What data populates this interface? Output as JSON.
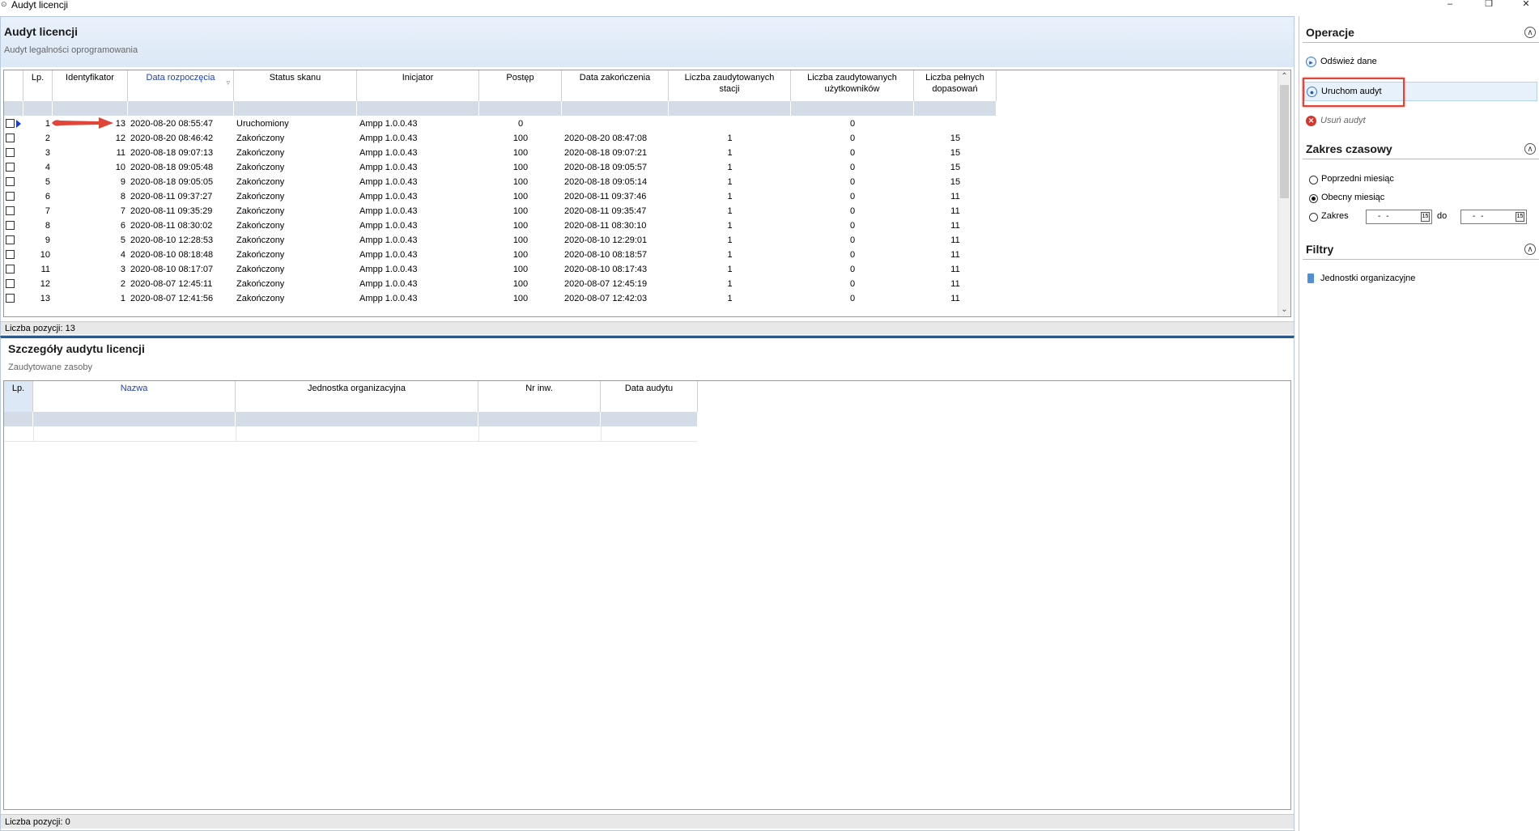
{
  "window": {
    "title": "Audyt licencji",
    "minimize": "–",
    "maximize": "❐",
    "close": "✕"
  },
  "audit_panel": {
    "title": "Audyt licencji",
    "subtitle": "Audyt legalności oprogramowania",
    "columns": [
      "Lp.",
      "Identyfikator",
      "Data rozpoczęcia",
      "Status skanu",
      "Inicjator",
      "Postęp",
      "Data zakończenia",
      "Liczba zaudytowanych stacji",
      "Liczba zaudytowanych użytkowników",
      "Liczba pełnych dopasowań"
    ],
    "rows": [
      [
        "1",
        "13",
        "2020-08-20 08:55:47",
        "Uruchomiony",
        "Ampp 1.0.0.43",
        "0",
        "",
        "",
        "0",
        ""
      ],
      [
        "2",
        "12",
        "2020-08-20 08:46:42",
        "Zakończony",
        "Ampp 1.0.0.43",
        "100",
        "2020-08-20 08:47:08",
        "1",
        "0",
        "15"
      ],
      [
        "3",
        "11",
        "2020-08-18 09:07:13",
        "Zakończony",
        "Ampp 1.0.0.43",
        "100",
        "2020-08-18 09:07:21",
        "1",
        "0",
        "15"
      ],
      [
        "4",
        "10",
        "2020-08-18 09:05:48",
        "Zakończony",
        "Ampp 1.0.0.43",
        "100",
        "2020-08-18 09:05:57",
        "1",
        "0",
        "15"
      ],
      [
        "5",
        "9",
        "2020-08-18 09:05:05",
        "Zakończony",
        "Ampp 1.0.0.43",
        "100",
        "2020-08-18 09:05:14",
        "1",
        "0",
        "15"
      ],
      [
        "6",
        "8",
        "2020-08-11 09:37:27",
        "Zakończony",
        "Ampp 1.0.0.43",
        "100",
        "2020-08-11 09:37:46",
        "1",
        "0",
        "11"
      ],
      [
        "7",
        "7",
        "2020-08-11 09:35:29",
        "Zakończony",
        "Ampp 1.0.0.43",
        "100",
        "2020-08-11 09:35:47",
        "1",
        "0",
        "11"
      ],
      [
        "8",
        "6",
        "2020-08-11 08:30:02",
        "Zakończony",
        "Ampp 1.0.0.43",
        "100",
        "2020-08-11 08:30:10",
        "1",
        "0",
        "11"
      ],
      [
        "9",
        "5",
        "2020-08-10 12:28:53",
        "Zakończony",
        "Ampp 1.0.0.43",
        "100",
        "2020-08-10 12:29:01",
        "1",
        "0",
        "11"
      ],
      [
        "10",
        "4",
        "2020-08-10 08:18:48",
        "Zakończony",
        "Ampp 1.0.0.43",
        "100",
        "2020-08-10 08:18:57",
        "1",
        "0",
        "11"
      ],
      [
        "11",
        "3",
        "2020-08-10 08:17:07",
        "Zakończony",
        "Ampp 1.0.0.43",
        "100",
        "2020-08-10 08:17:43",
        "1",
        "0",
        "11"
      ],
      [
        "12",
        "2",
        "2020-08-07 12:45:11",
        "Zakończony",
        "Ampp 1.0.0.43",
        "100",
        "2020-08-07 12:45:19",
        "1",
        "0",
        "11"
      ],
      [
        "13",
        "1",
        "2020-08-07 12:41:56",
        "Zakończony",
        "Ampp 1.0.0.43",
        "100",
        "2020-08-07 12:42:03",
        "1",
        "0",
        "11"
      ]
    ],
    "footer": "Liczba pozycji: 13"
  },
  "details_panel": {
    "title": "Szczegóły audytu licencji",
    "subtitle": "Zaudytowane zasoby",
    "columns": [
      "Lp.",
      "Nazwa",
      "Jednostka organizacyjna",
      "Nr inw.",
      "Data audytu"
    ],
    "footer": "Liczba pozycji: 0"
  },
  "sidebar": {
    "operations": {
      "title": "Operacje",
      "items": [
        "Odśwież dane",
        "Uruchom audyt",
        "Usuń audyt"
      ]
    },
    "time_range": {
      "title": "Zakres czasowy",
      "options": [
        "Poprzedni miesiąc",
        "Obecny miesiąc",
        "Zakres"
      ],
      "selected": "Obecny miesiąc",
      "date_from": "- -",
      "date_to_label": "do",
      "date_to": "- -",
      "calendar_glyph": "15"
    },
    "filters": {
      "title": "Filtry",
      "items": [
        "Jednostki organizacyjne"
      ]
    }
  },
  "colors": {
    "accent_blue": "#1a3fd0",
    "header_gradient": "#dce8f6",
    "highlight_red": "#e0453a",
    "delete_red": "#d9342b",
    "divider_blue": "#1f5c9e"
  },
  "icons": {
    "refresh": "play-circle-icon",
    "run": "gear-circle-icon",
    "delete": "x-circle-icon",
    "filter_org": "org-unit-icon"
  }
}
